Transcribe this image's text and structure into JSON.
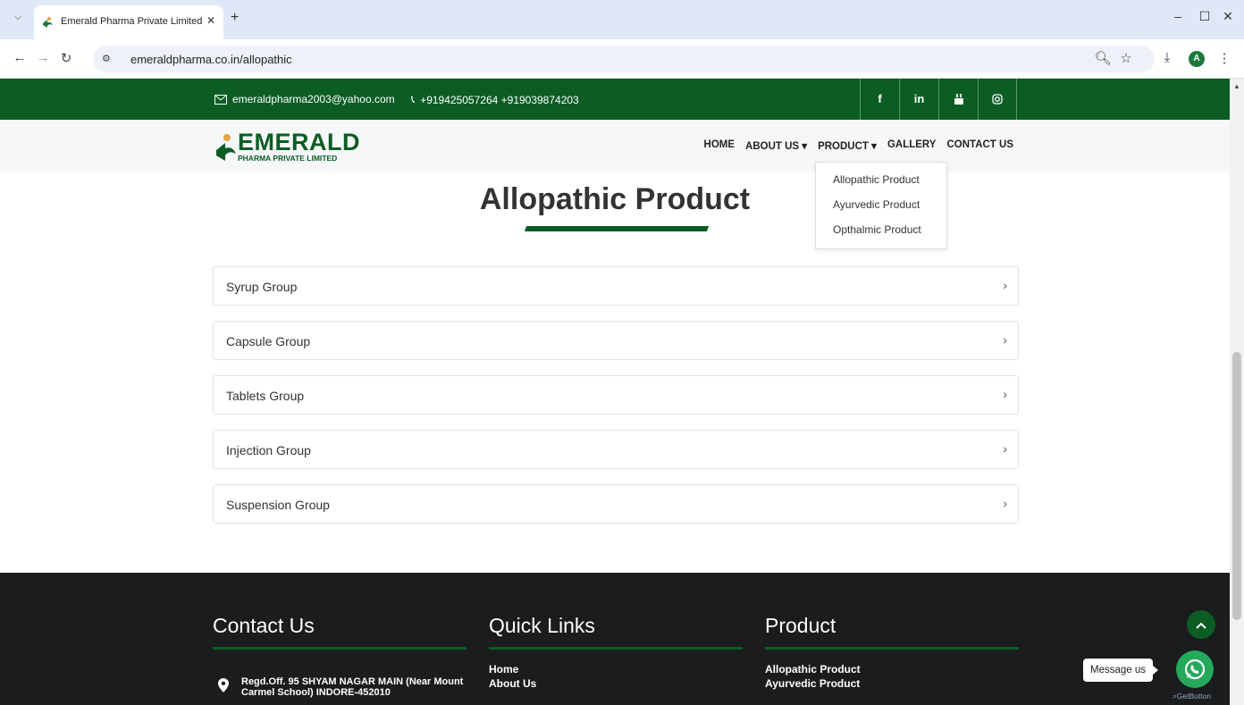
{
  "browser": {
    "tab_title": "Emerald Pharma Private Limited",
    "url": "emeraldpharma.co.in/allopathic",
    "new_tab": "+",
    "profile_initial": "A"
  },
  "topbar": {
    "email": "emeraldpharma2003@yahoo.com",
    "phone": "+919425057264 +919039874203",
    "social": [
      "f",
      "in",
      "youtube-icon",
      "instagram-icon"
    ]
  },
  "logo": {
    "word": "EMERALD",
    "sub": "PHARMA PRIVATE LIMITED"
  },
  "nav": {
    "home": "HOME",
    "about": "ABOUT US",
    "product": "PRODUCT",
    "gallery": "GALLERY",
    "contact": "CONTACT US"
  },
  "dropdown": [
    "Allopathic Product",
    "Ayurvedic Product",
    "Opthalmic Product"
  ],
  "page_title": "Allopathic Product",
  "groups": [
    "Syrup Group",
    "Capsule Group",
    "Tablets Group",
    "Injection Group",
    "Suspension Group"
  ],
  "footer": {
    "contact_title": "Contact Us",
    "quick_title": "Quick Links",
    "product_title": "Product",
    "address": "Regd.Off. 95 SHYAM NAGAR MAIN (Near Mount Carmel School) INDORE-452010",
    "quick_links": [
      "Home",
      "About Us"
    ],
    "product_links": [
      "Allopathic Product",
      "Ayurvedic Product"
    ]
  },
  "widgets": {
    "message_us": "Message us",
    "getbutton": "GetButton"
  },
  "colors": {
    "brand_green": "#0b5d24",
    "footer_bg": "#1a1c1e"
  }
}
